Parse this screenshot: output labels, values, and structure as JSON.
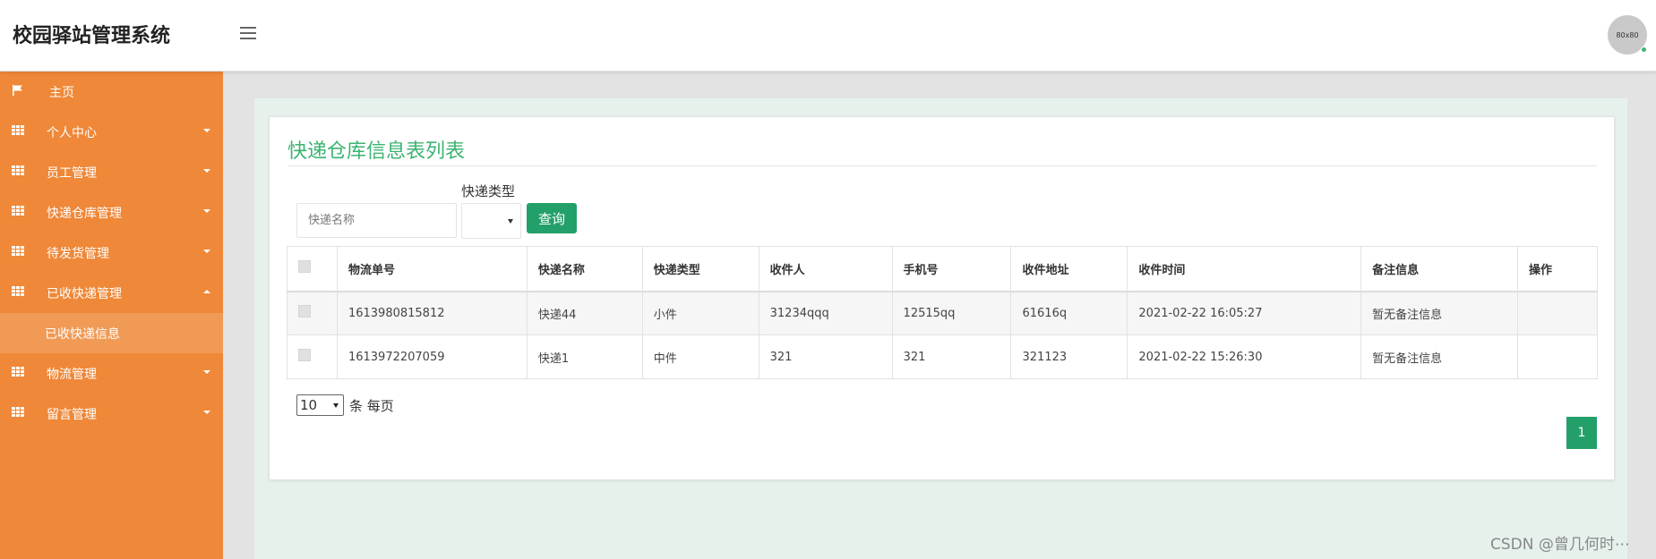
{
  "app": {
    "title": "校园驿站管理系统",
    "avatar_text": "80x80",
    "colors": {
      "sidebar": "#ef8838",
      "sidebar_sub": "#f09a55",
      "accent": "#3cb371",
      "button": "#23a06a"
    }
  },
  "sidebar": {
    "items": [
      {
        "label": "主页",
        "icon": "flag-icon"
      },
      {
        "label": "个人中心",
        "icon": "grid-icon"
      },
      {
        "label": "员工管理",
        "icon": "grid-icon"
      },
      {
        "label": "快递仓库管理",
        "icon": "grid-icon"
      },
      {
        "label": "待发货管理",
        "icon": "grid-icon"
      },
      {
        "label": "已收快递管理",
        "icon": "grid-icon",
        "expanded": true
      },
      {
        "label": "物流管理",
        "icon": "grid-icon"
      },
      {
        "label": "留言管理",
        "icon": "grid-icon"
      }
    ],
    "sub_item": {
      "label": "已收快递信息"
    }
  },
  "main": {
    "title": "快递仓库信息表列表",
    "search": {
      "placeholder": "快递名称",
      "value": ""
    },
    "type_label": "快递类型",
    "type_value": "",
    "query_label": "查询",
    "table": {
      "columns": [
        "",
        "物流单号",
        "快递名称",
        "快递类型",
        "收件人",
        "手机号",
        "收件地址",
        "收件时间",
        "备注信息",
        "操作"
      ],
      "rows": [
        [
          "",
          "1613980815812",
          "快递44",
          "小件",
          "31234qqq",
          "12515qq",
          "61616q",
          "2021-02-22 16:05:27",
          "暂无备注信息",
          ""
        ],
        [
          "",
          "1613972207059",
          "快递1",
          "中件",
          "321",
          "321",
          "321123",
          "2021-02-22 15:26:30",
          "暂无备注信息",
          ""
        ]
      ]
    },
    "pagination": {
      "per_page": "10",
      "per_page_suffix": "条 每页",
      "current_page": "1"
    }
  },
  "watermark": "CSDN @曾几何时⋯"
}
